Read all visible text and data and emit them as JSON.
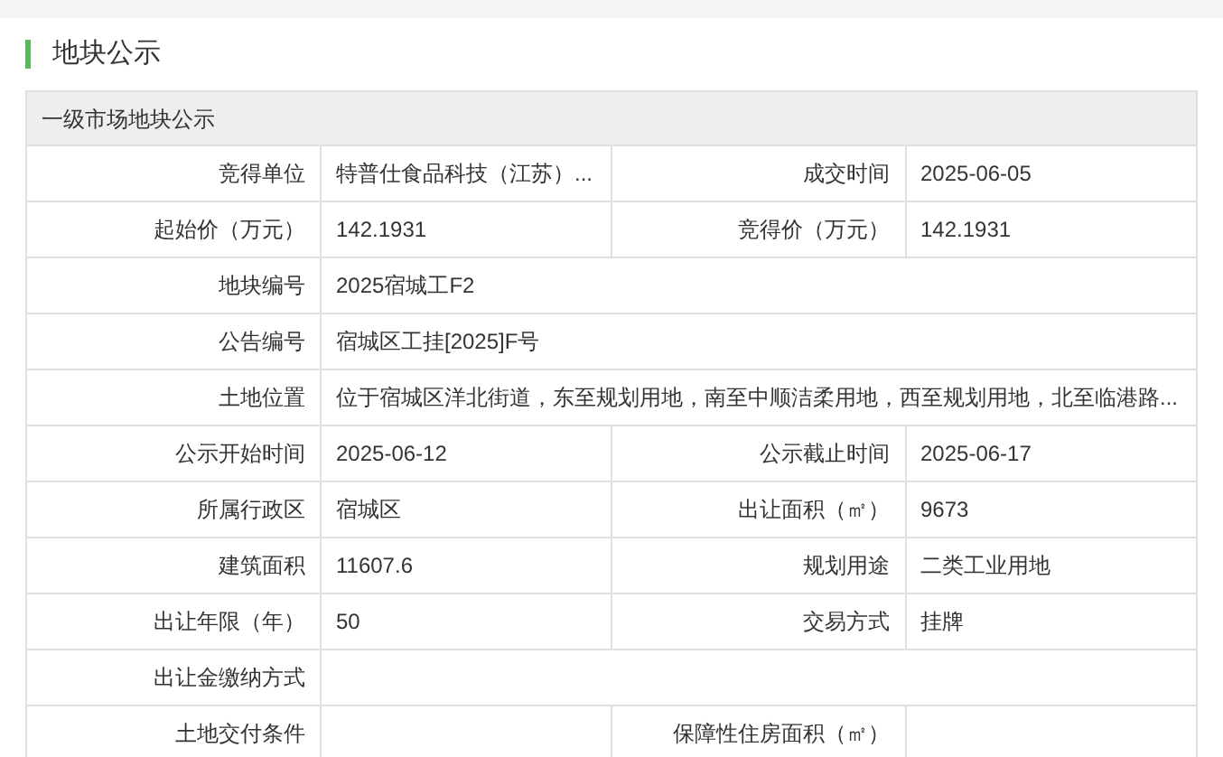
{
  "title": "地块公示",
  "table": {
    "heading": "一级市场地块公示",
    "rows": [
      [
        {
          "label": "竞得单位",
          "value": "特普仕食品科技（江苏）..."
        },
        {
          "label": "成交时间",
          "value": "2025-06-05"
        }
      ],
      [
        {
          "label": "起始价（万元）",
          "value": "142.1931"
        },
        {
          "label": "竞得价（万元）",
          "value": "142.1931"
        }
      ],
      [
        {
          "label": "地块编号",
          "value": "2025宿城工F2"
        }
      ],
      [
        {
          "label": "公告编号",
          "value": "宿城区工挂[2025]F号"
        }
      ],
      [
        {
          "label": "土地位置",
          "value": "位于宿城区洋北街道，东至规划用地，南至中顺洁柔用地，西至规划用地，北至临港路..."
        }
      ],
      [
        {
          "label": "公示开始时间",
          "value": "2025-06-12"
        },
        {
          "label": "公示截止时间",
          "value": "2025-06-17"
        }
      ],
      [
        {
          "label": "所属行政区",
          "value": "宿城区"
        },
        {
          "label": "出让面积（㎡）",
          "value": "9673"
        }
      ],
      [
        {
          "label": "建筑面积",
          "value": "11607.6"
        },
        {
          "label": "规划用途",
          "value": "二类工业用地"
        }
      ],
      [
        {
          "label": "出让年限（年）",
          "value": "50"
        },
        {
          "label": "交易方式",
          "value": "挂牌"
        }
      ],
      [
        {
          "label": "出让金缴纳方式"
        }
      ],
      [
        {
          "label": "土地交付条件"
        },
        {
          "label": "保障性住房面积（㎡）"
        }
      ]
    ]
  }
}
